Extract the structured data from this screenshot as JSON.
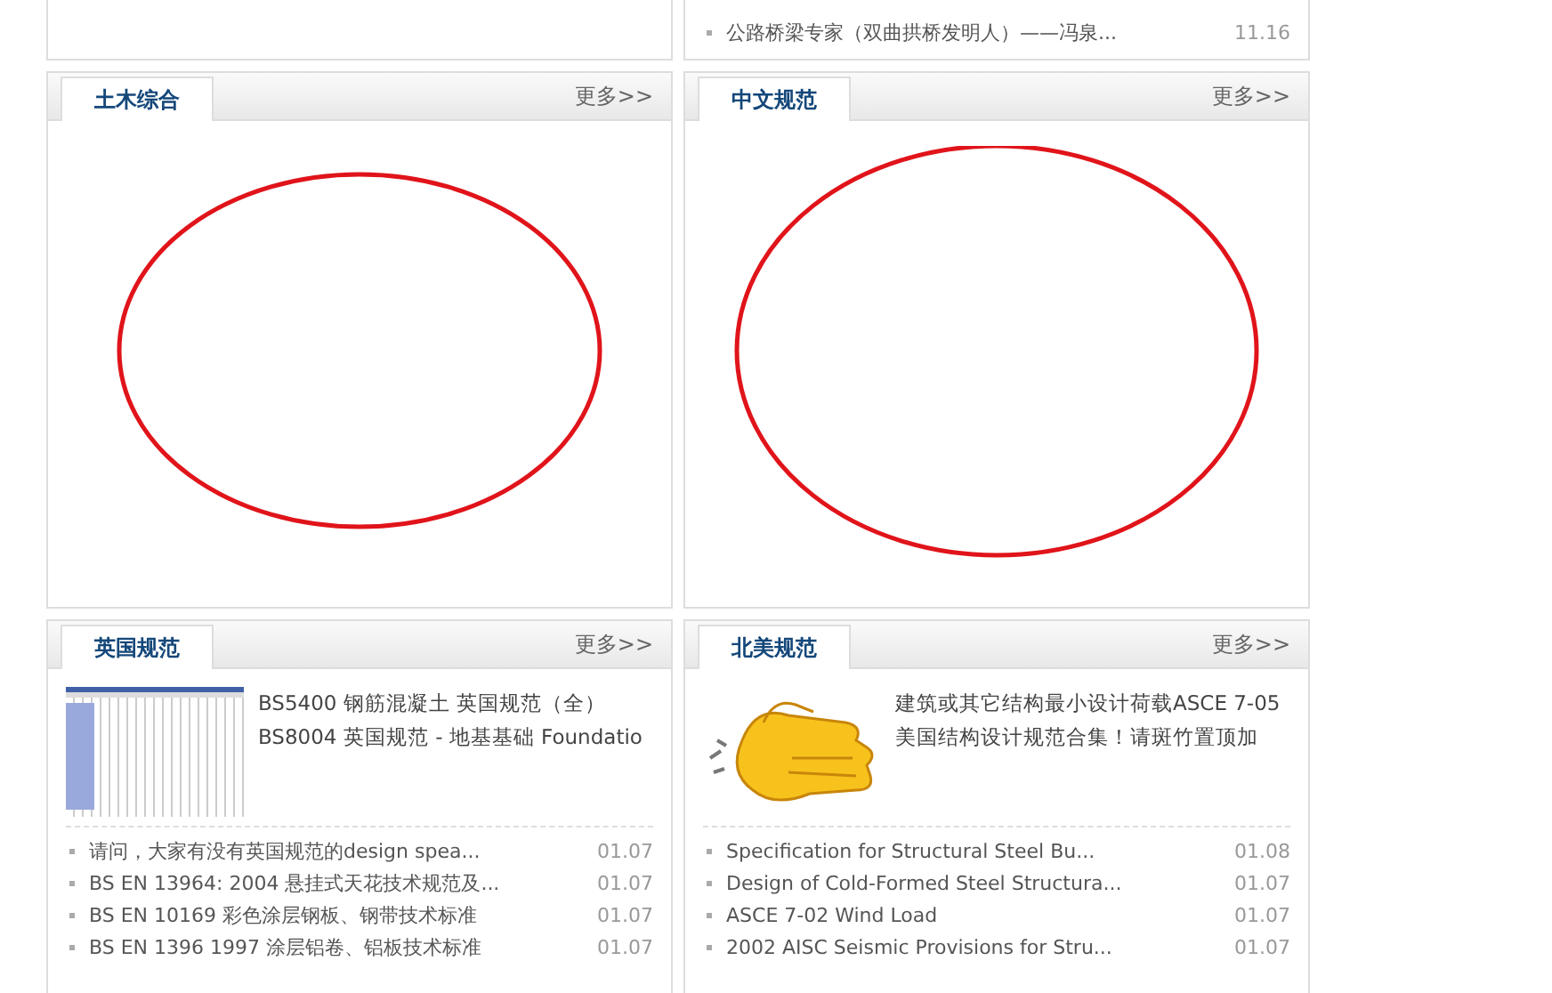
{
  "top_right_panel": {
    "items": [
      {
        "title": "公路桥梁专家（双曲拱桥发明人）——冯泉...",
        "date": "11.16"
      }
    ]
  },
  "panels": [
    {
      "title": "土木综合",
      "more": "更多>>",
      "circled": true
    },
    {
      "title": "中文规范",
      "more": "更多>>",
      "circled": true
    },
    {
      "title": "英国规范",
      "more": "更多>>",
      "feature": {
        "kind": "screenshot",
        "lines": [
          "BS5400 钢筋混凝土  英国规范（全）",
          "BS8004 英国规范  - 地基基础  Foundatio"
        ]
      },
      "items": [
        {
          "title": "请问，大家有没有英国规范的design spea...",
          "date": "01.07"
        },
        {
          "title": "BS EN 13964: 2004 悬挂式天花技术规范及...",
          "date": "01.07"
        },
        {
          "title": "BS EN 10169 彩色涂层钢板、钢带技术标准",
          "date": "01.07"
        },
        {
          "title": "BS EN 1396 1997 涂层铝卷、铝板技术标准",
          "date": "01.07"
        }
      ]
    },
    {
      "title": "北美规范",
      "more": "更多>>",
      "feature": {
        "kind": "clapping",
        "lines": [
          "建筑或其它结构最小设计荷载ASCE 7-05",
          "美国结构设计规范合集！请斑竹置顶加"
        ]
      },
      "items": [
        {
          "title": "Specification for Structural Steel Bu...",
          "date": "01.08"
        },
        {
          "title": "Design of Cold-Formed Steel Structura...",
          "date": "01.07"
        },
        {
          "title": "ASCE 7-02 Wind Load",
          "date": "01.07"
        },
        {
          "title": "2002 AISC Seismic Provisions for Stru...",
          "date": "01.07"
        }
      ]
    }
  ]
}
